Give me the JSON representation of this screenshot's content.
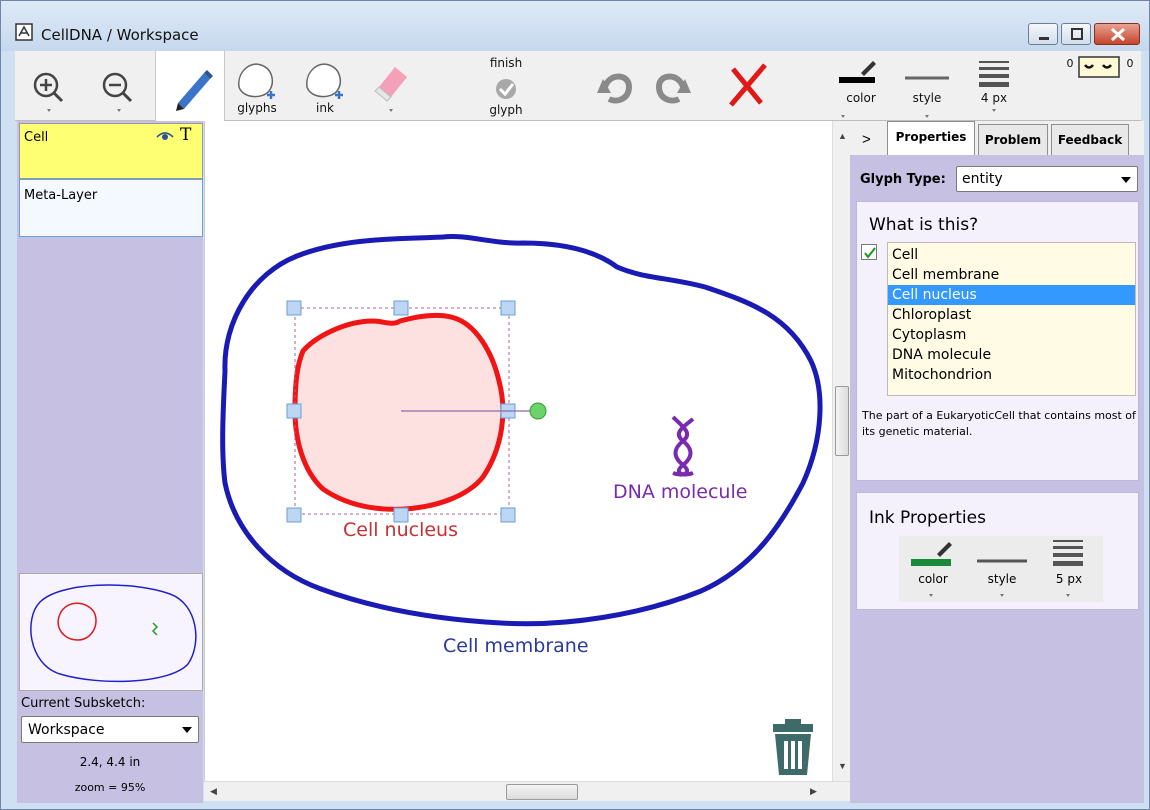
{
  "window": {
    "title": "CellDNA / Workspace"
  },
  "toolbar": {
    "glyphs_label": "glyphs",
    "ink_label": "ink",
    "finish_line1": "finish",
    "finish_line2": "glyph",
    "color_label": "color",
    "style_label": "style",
    "width_label": "4 px",
    "counter_left": "0",
    "counter_right": "0"
  },
  "layers": [
    {
      "name": "Cell",
      "color": "#ffff73"
    },
    {
      "name": "Meta-Layer"
    }
  ],
  "left_panel": {
    "subsketch_label": "Current Subsketch:",
    "subsketch_value": "Workspace",
    "coordinates": "2.4, 4.4 in",
    "zoom": "zoom = 95%"
  },
  "canvas": {
    "labels": {
      "nucleus": "Cell nucleus",
      "dna": "DNA molecule",
      "membrane": "Cell membrane"
    },
    "colors": {
      "membrane": "#1a1ab4",
      "nucleus": "#f01414",
      "nucleus_fill": "#fde0e0",
      "dna": "#7a2ab0",
      "selection": "#7ab0e8"
    }
  },
  "right_panel": {
    "tabs": [
      "Properties",
      "Problem",
      "Feedback"
    ],
    "active_tab": "Properties",
    "glyph_type_label": "Glyph Type:",
    "glyph_type_value": "entity",
    "what_title": "What is this?",
    "options": [
      "Cell",
      "Cell membrane",
      "Cell nucleus",
      "Chloroplast",
      "Cytoplasm",
      "DNA molecule",
      "Mitochondrion"
    ],
    "selected_option": "Cell nucleus",
    "description": "The part of a EukaryoticCell that contains most of its genetic material.",
    "ink_title": "Ink Properties",
    "ink_color_label": "color",
    "ink_style_label": "style",
    "ink_width_label": "5 px",
    "ink_color": "#1a8a3a"
  },
  "icons": [
    "zoom-in-icon",
    "zoom-out-icon",
    "pen-icon",
    "glyphs-icon",
    "ink-icon",
    "eraser-icon",
    "finish-glyph-icon",
    "undo-icon",
    "redo-icon",
    "delete-icon",
    "trash-icon"
  ]
}
